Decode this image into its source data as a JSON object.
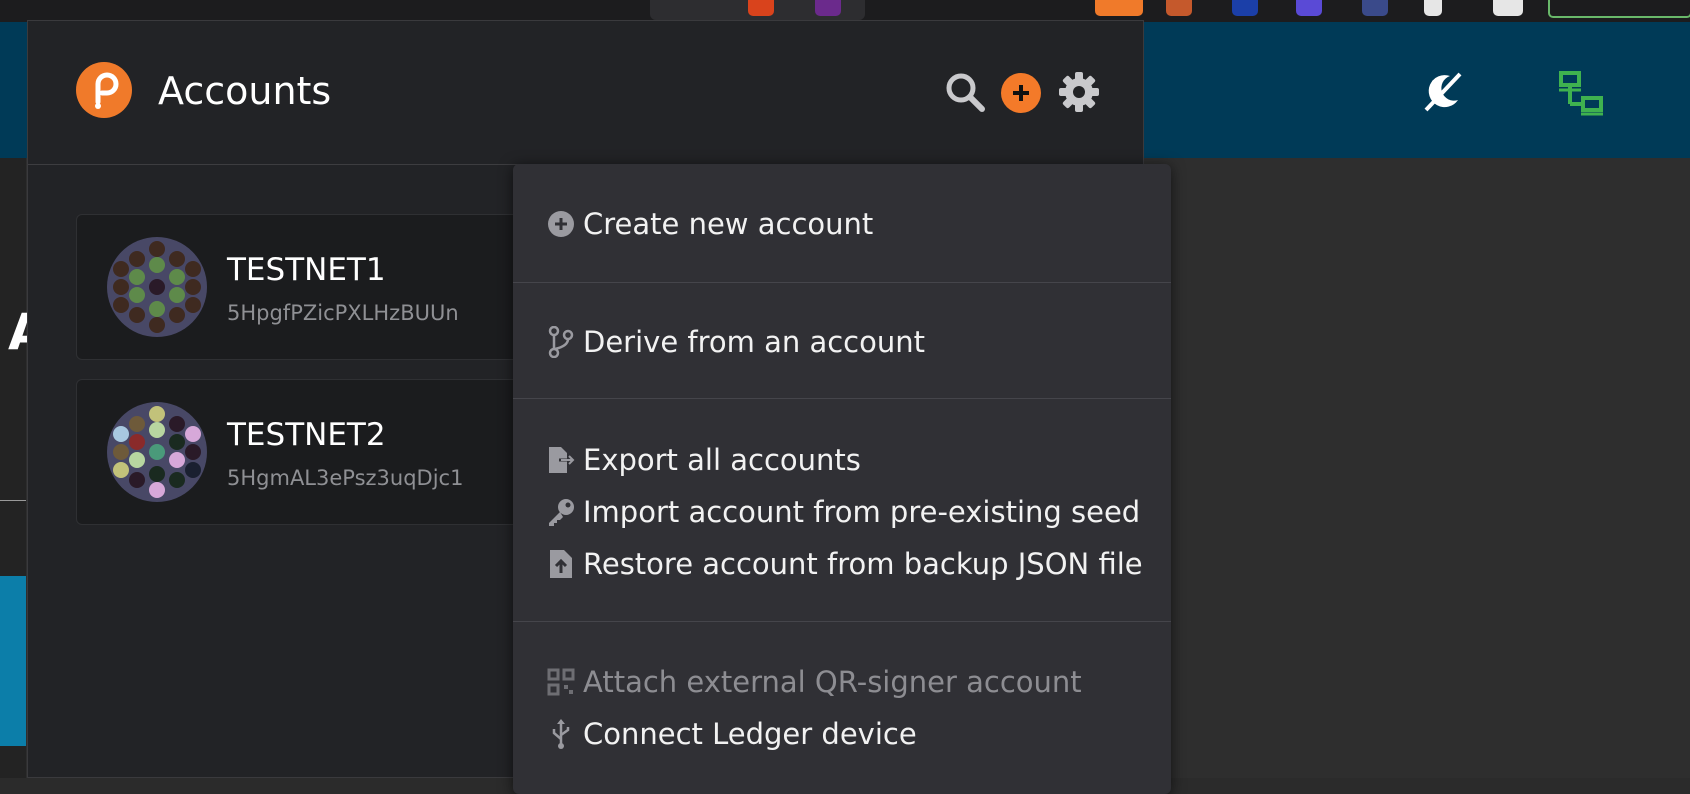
{
  "app": {
    "title": "Accounts"
  },
  "accounts": [
    {
      "name": "TESTNET1",
      "address": "5HpgfPZicPXLHzBUUn"
    },
    {
      "name": "TESTNET2",
      "address": "5HgmAL3ePsz3uqDjc1"
    }
  ],
  "menu": {
    "create_new_account": "Create new account",
    "derive_from_account": "Derive from an account",
    "export_all_accounts": "Export all accounts",
    "import_from_seed": "Import account from pre-existing seed",
    "restore_from_json": "Restore account from backup JSON file",
    "attach_qr_signer": "Attach external QR-signer account",
    "connect_ledger": "Connect Ledger device"
  },
  "background": {
    "left_heading_fragment": "A"
  },
  "colors": {
    "accent": "#f47a29",
    "page_header": "#003a57",
    "popup_bg": "#222326",
    "menu_bg": "#303035",
    "network_icon": "#3fb24f"
  },
  "icons": {
    "logo": "polkadot-logo-icon",
    "search": "search-icon",
    "add": "add-icon",
    "settings": "gear-icon",
    "theme": "theme-toggle-icon",
    "network": "network-icon"
  }
}
